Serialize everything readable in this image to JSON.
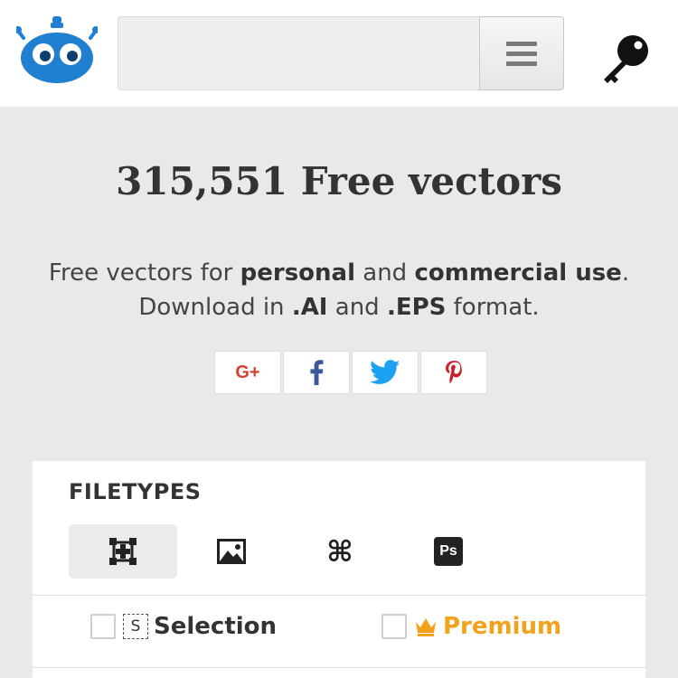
{
  "header": {
    "search_placeholder": "",
    "menu_icon": "hamburger-icon",
    "login_icon": "key-icon",
    "logo_icon": "robot-logo"
  },
  "hero": {
    "title": "315,551 Free vectors",
    "line1_part1": "Free vectors for ",
    "line1_bold1": "personal",
    "line1_part2": " and ",
    "line1_bold2": "commercial use",
    "line1_part3": ".",
    "line2_part1": "Download in ",
    "line2_bold1": ".AI",
    "line2_part2": " and ",
    "line2_bold2": ".EPS",
    "line2_part3": " format."
  },
  "share": {
    "buttons": [
      "google-plus-icon",
      "facebook-icon",
      "twitter-icon",
      "pinterest-icon"
    ],
    "google_plus_label": "G+"
  },
  "filetypes": {
    "title": "FILETYPES",
    "types": [
      "vector-icon",
      "image-icon",
      "command-icon",
      "photoshop-icon"
    ],
    "active_index": 0,
    "ps_label": "Ps"
  },
  "options": {
    "selection_icon_letter": "S",
    "selection_label": "Selection",
    "premium_label": "Premium"
  },
  "colors": {
    "brand_blue": "#1f7fd1",
    "premium_orange": "#f4a21b",
    "google_red": "#d6402e",
    "facebook_blue": "#3b5998",
    "twitter_blue": "#1da1f2",
    "pinterest_red": "#c8232c"
  }
}
